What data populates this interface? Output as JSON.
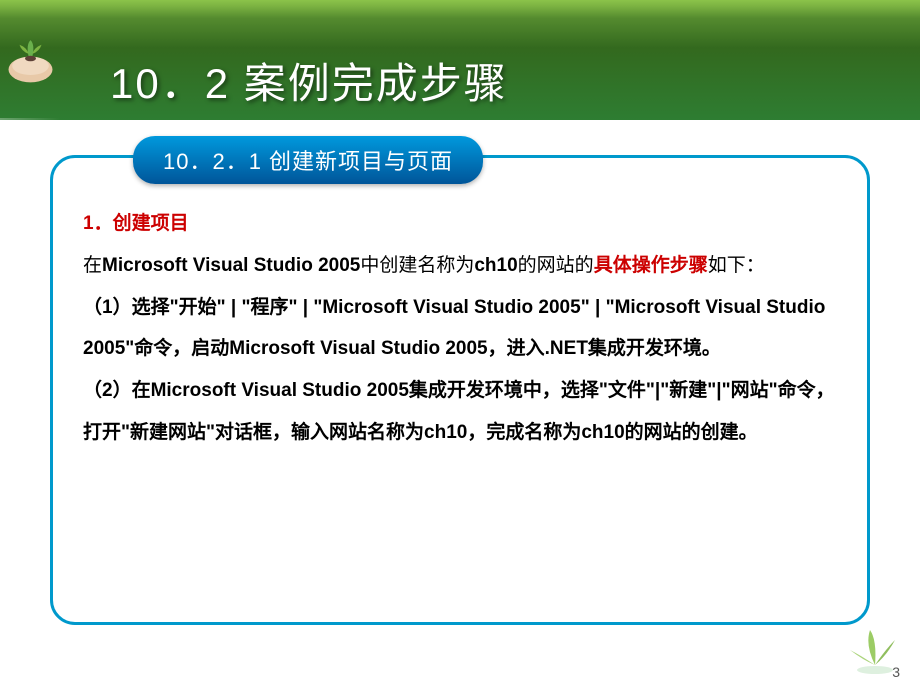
{
  "banner": {
    "title": "10．2  案例完成步骤"
  },
  "pill": {
    "label": "10．2．1  创建新项目与页面"
  },
  "doc": {
    "heading_num": "1．",
    "heading_text": "创建项目",
    "p1_a": "在",
    "p1_b": "Microsoft Visual Studio 2005",
    "p1_c": "中创建名称为",
    "p1_d": "ch10",
    "p1_e": "的网站的",
    "p1_red": "具体操作步骤",
    "p1_f": "如下：",
    "s1_a": "（1）选择\"开始\" | \"程序\" | \"",
    "s1_b": "Microsoft Visual Studio 2005",
    "s1_c": "\" | \"",
    "s1_d": "Microsoft Visual Studio 2005",
    "s1_e": "\"命令，启动",
    "s1_f": "Microsoft Visual Studio 2005",
    "s1_g": "，进入",
    "s1_h": ".NET",
    "s1_i": "集成开发环境。",
    "s2_a": "（2）在",
    "s2_b": "Microsoft Visual Studio 2005",
    "s2_c": "集成开发环境中，选择\"文件\"|\"新建\"|\"网站\"命令，打开\"新建网站\"对话框，输入网站名称为",
    "s2_d": "ch10",
    "s2_e": "，完成名称为",
    "s2_f": "ch10",
    "s2_g": "的网站的创建。"
  },
  "footer": {
    "page": "3"
  }
}
